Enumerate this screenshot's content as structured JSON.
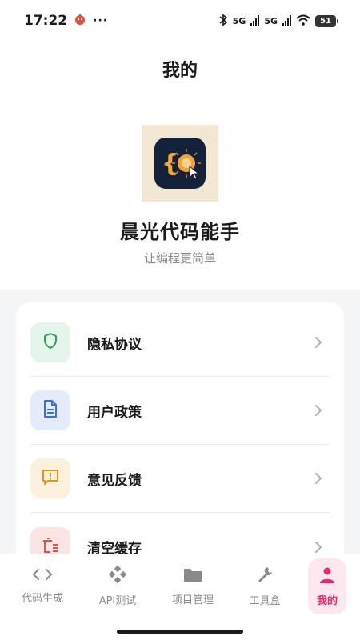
{
  "status_bar": {
    "time": "17:22",
    "extra": "···",
    "network": "5G",
    "network2": "5G",
    "battery": "51"
  },
  "header": {
    "title": "我的"
  },
  "profile": {
    "app_name": "晨光代码能手",
    "slogan": "让编程更简单"
  },
  "menu": [
    {
      "label": "隐私协议",
      "icon": "shield-icon",
      "bg": "#e6f5ec",
      "color": "#2f9e5a"
    },
    {
      "label": "用户政策",
      "icon": "document-icon",
      "bg": "#e4ecfb",
      "color": "#3b6fd8"
    },
    {
      "label": "意见反馈",
      "icon": "feedback-icon",
      "bg": "#fdf1de",
      "color": "#d99a22"
    },
    {
      "label": "清空缓存",
      "icon": "clear-cache-icon",
      "bg": "#fbe4e4",
      "color": "#d9534f"
    }
  ],
  "tabs": [
    {
      "label": "代码生成",
      "icon": "code-icon"
    },
    {
      "label": "API测试",
      "icon": "api-icon"
    },
    {
      "label": "项目管理",
      "icon": "folder-icon"
    },
    {
      "label": "工具盒",
      "icon": "wrench-icon"
    },
    {
      "label": "我的",
      "icon": "person-icon",
      "active": true
    }
  ],
  "colors": {
    "accent": "#d6336c",
    "tab_inactive": "#8a8a8a"
  }
}
